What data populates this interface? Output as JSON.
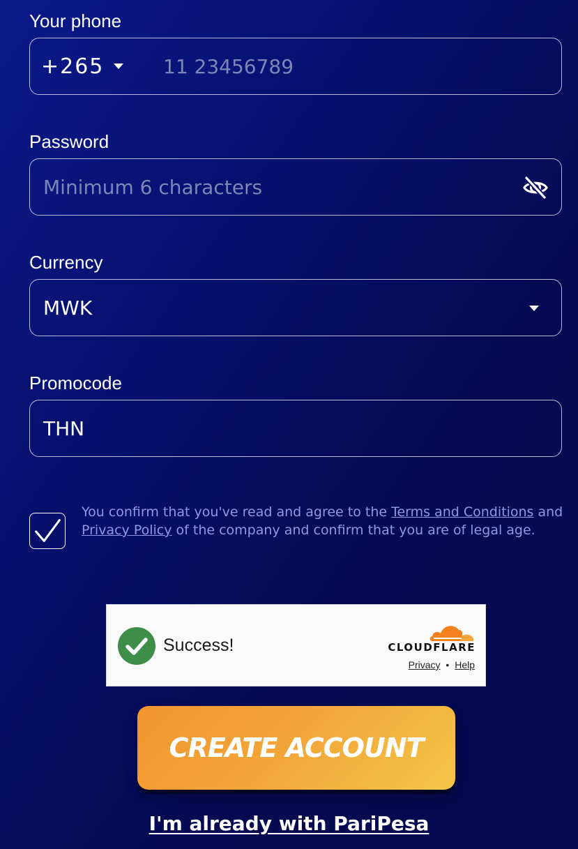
{
  "phone": {
    "label": "Your phone",
    "country_code": "+265",
    "placeholder": "11 23456789"
  },
  "password": {
    "label": "Password",
    "placeholder": "Minimum 6 characters",
    "toggle_icon": "eye-slash-icon"
  },
  "currency": {
    "label": "Currency",
    "selected": "MWK"
  },
  "promocode": {
    "label": "Promocode",
    "value": "THN"
  },
  "consent": {
    "checked": true,
    "text_before": "You confirm that you've read and agree to the ",
    "terms_link": "Terms and Conditions",
    "text_and": " and ",
    "privacy_link": "Privacy Policy",
    "text_after": " of the company and confirm that you are of legal age."
  },
  "captcha": {
    "status": "Success!",
    "brand": "CLOUDFLARE",
    "privacy_link": "Privacy",
    "separator": "•",
    "help_link": "Help"
  },
  "create_account_label": "CREATE ACCOUNT",
  "login_link": "I'm already with PariPesa",
  "colors": {
    "background": "#07106a",
    "button_start": "#f2952e",
    "button_end": "#f4c547",
    "consent_text": "#8e98e6",
    "success_green": "#3e8e4a",
    "cloudflare_orange": "#f48120"
  }
}
